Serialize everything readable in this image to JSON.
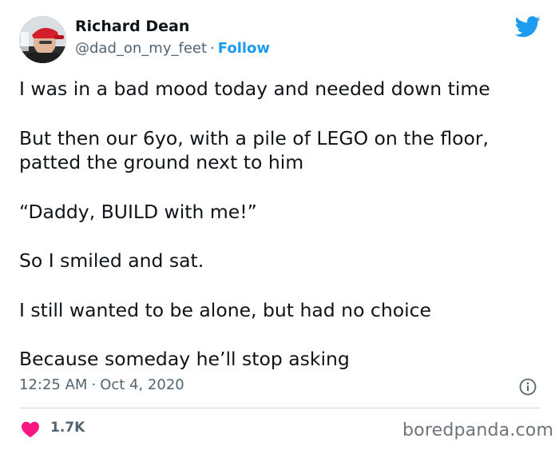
{
  "tweet": {
    "user": {
      "name": "Richard Dean",
      "handle": "@dad_on_my_feet",
      "separator": "·",
      "follow_label": "Follow"
    },
    "lines": [
      "I was in a bad mood today and needed down time",
      "But then our 6yo, with a pile of LEGO on the floor,",
      "patted the ground next to him",
      "“Daddy, BUILD with me!”",
      "So I smiled and sat.",
      "I still wanted to be alone, but had no choice",
      "Because someday he’ll stop asking"
    ],
    "time": "12:25 AM",
    "date": "Oct 4, 2020",
    "likes": "1.7K"
  },
  "watermark": "boredpanda.com",
  "icons": {
    "brand": "twitter-bird-icon",
    "info": "info-icon",
    "like": "heart-icon"
  },
  "colors": {
    "accent": "#1d9bf0",
    "heart": "#f91880",
    "secondary_text": "#536471"
  }
}
